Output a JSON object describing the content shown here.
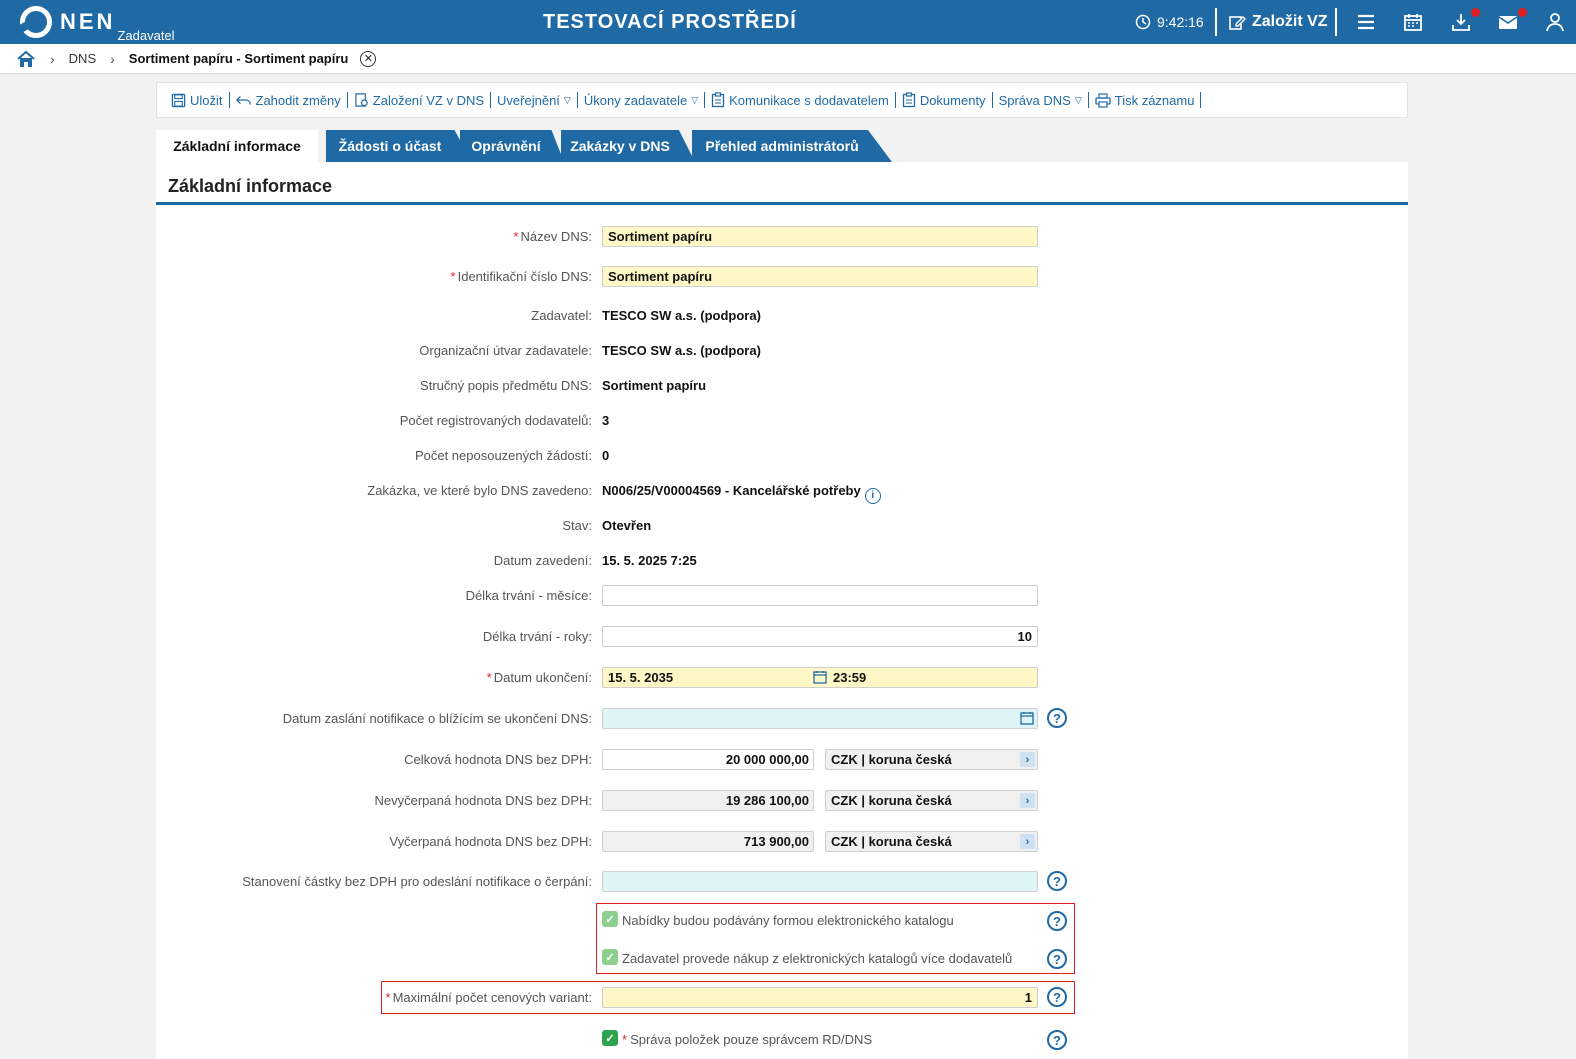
{
  "header": {
    "logo": "NEN",
    "role": "Zadavatel",
    "environment": "TESTOVACÍ PROSTŘEDÍ",
    "time": "9:42:16",
    "create_label": "Založit VZ",
    "icons": [
      "clock-icon",
      "edit-icon",
      "menu-icon",
      "calendar-icon",
      "download-icon",
      "mail-icon",
      "user-icon"
    ]
  },
  "breadcrumb": {
    "items": [
      "DNS"
    ],
    "current": "Sortiment papíru - Sortiment papíru",
    "close": "✕"
  },
  "toolbar": {
    "save": "Uložit",
    "discard": "Zahodit změny",
    "create_vz": "Založení VZ v DNS",
    "publish": "Uveřejnění",
    "actions": "Úkony zadavatele",
    "communication": "Komunikace s dodavatelem",
    "documents": "Dokumenty",
    "dns_admin": "Správa DNS",
    "print": "Tisk záznamu"
  },
  "tabs": [
    "Základní informace",
    "Žádosti o účast",
    "Oprávnění",
    "Zakázky v DNS",
    "Přehled administrátorů"
  ],
  "section_title": "Základní informace",
  "form": {
    "name_label": "Název DNS:",
    "name_value": "Sortiment papíru",
    "id_label": "Identifikační číslo DNS:",
    "id_value": "Sortiment papíru",
    "contracting_label": "Zadavatel:",
    "contracting_value": "TESCO SW a.s. (podpora)",
    "org_label": "Organizační útvar zadavatele:",
    "org_value": "TESCO SW a.s. (podpora)",
    "desc_label": "Stručný popis předmětu DNS:",
    "desc_value": "Sortiment papíru",
    "registered_label": "Počet registrovaných dodavatelů:",
    "registered_value": "3",
    "unassessed_label": "Počet neposouzených žádostí:",
    "unassessed_value": "0",
    "contract_label": "Zakázka, ve které bylo DNS zavedeno:",
    "contract_value": "N006/25/V00004569 - Kancelářské potřeby",
    "state_label": "Stav:",
    "state_value": "Otevřen",
    "date_intro_label": "Datum zavedení:",
    "date_intro_value": "15. 5. 2025 7:25",
    "months_label": "Délka trvání - měsíce:",
    "months_value": "",
    "years_label": "Délka trvání - roky:",
    "years_value": "10",
    "end_label": "Datum ukončení:",
    "end_date": "15. 5. 2035",
    "end_time": "23:59",
    "notif_label": "Datum zaslání notifikace o blížícím se ukončení DNS:",
    "notif_value": "",
    "total_label": "Celková hodnota DNS bez DPH:",
    "total_value": "20 000 000,00",
    "unused_label": "Nevyčerpaná hodnota DNS bez DPH:",
    "unused_value": "19 286 100,00",
    "used_label": "Vyčerpaná hodnota DNS bez DPH:",
    "used_value": "713 900,00",
    "currency": "CZK | koruna česká",
    "threshold_label": "Stanovení částky bez DPH pro odeslání notifikace o čerpání:",
    "threshold_value": "",
    "catalog1": "Nabídky budou podávány formou elektronického katalogu",
    "catalog2": "Zadavatel provede nákup z elektronických katalogů více dodavatelů",
    "variants_label": "Maximální počet cenových variant:",
    "variants_value": "1",
    "items_admin": "Správa položek pouze správcem RD/DNS",
    "required_mark": "*",
    "help": "?",
    "info": "i",
    "check": "✓",
    "chevron": "›"
  },
  "colors": {
    "brand": "#1f6aa5",
    "required_bg": "#fff8c6",
    "cyan_bg": "#dff4f7",
    "highlight": "#e02020",
    "check_green": "#2ea44f"
  }
}
